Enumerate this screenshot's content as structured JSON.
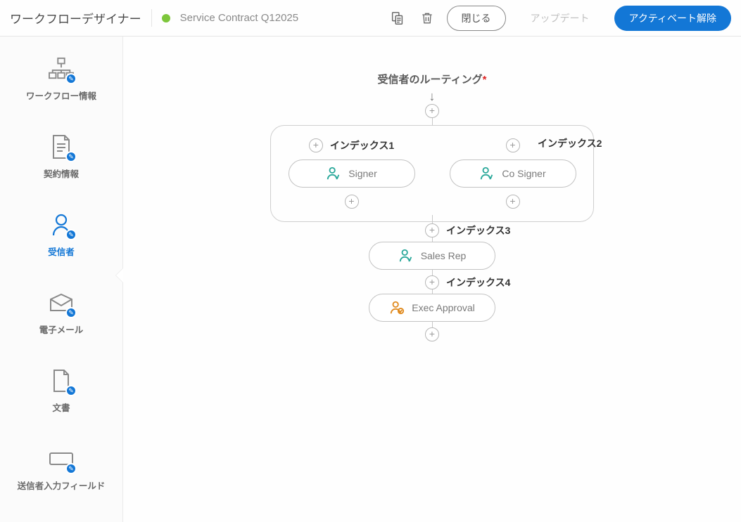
{
  "header": {
    "title": "ワークフローデザイナー",
    "contract": "Service Contract Q12025",
    "close": "閉じる",
    "update": "アップデート",
    "deactivate": "アクティベート解除"
  },
  "sidebar": {
    "items": [
      {
        "label": "ワークフロー情報"
      },
      {
        "label": "契約情報"
      },
      {
        "label": "受信者"
      },
      {
        "label": "電子メール"
      },
      {
        "label": "文書"
      },
      {
        "label": "送信者入力フィールド"
      }
    ]
  },
  "canvas": {
    "routing_title": "受信者のルーティング",
    "index1": "インデックス1",
    "index2": "インデックス2",
    "index3": "インデックス3",
    "index4": "インデックス4",
    "signer": "Signer",
    "cosigner": "Co Signer",
    "salesrep": "Sales Rep",
    "execapproval": "Exec Approval"
  }
}
